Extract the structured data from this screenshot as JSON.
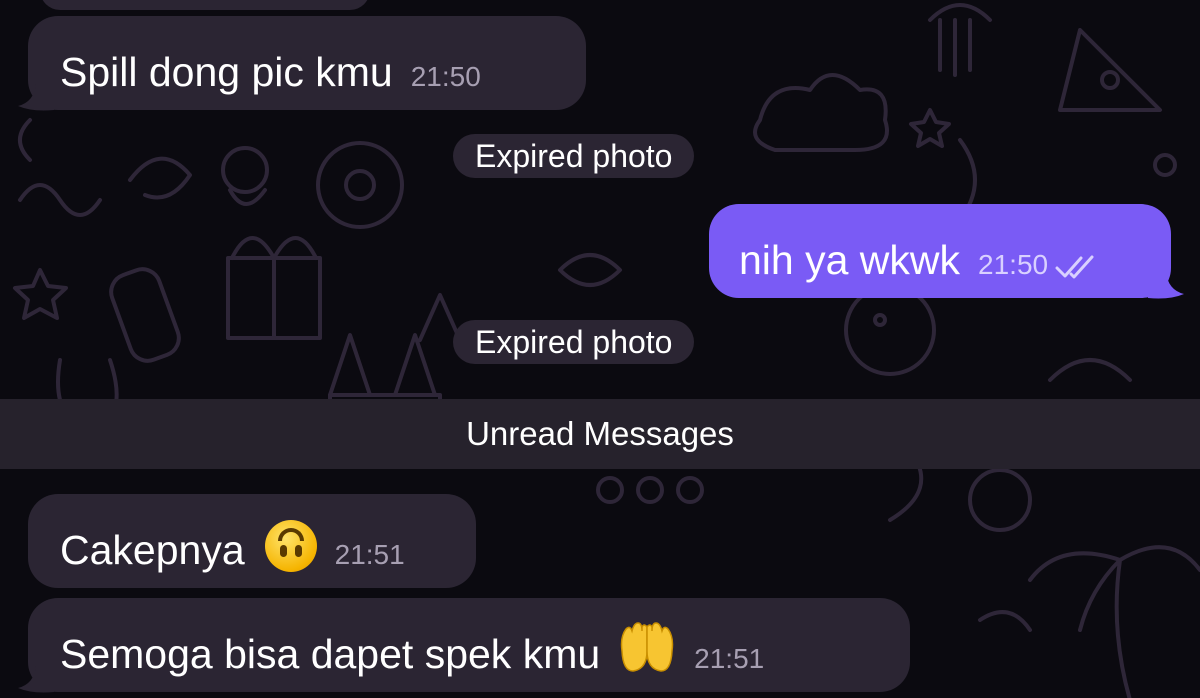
{
  "messages": {
    "m1": {
      "text": "Spill dong pic kmu",
      "time": "21:50"
    },
    "m2": {
      "text": "nih ya wkwk",
      "time": "21:50"
    },
    "m3": {
      "text": "Cakepnya",
      "time": "21:51",
      "emoji": "upside-down-face"
    },
    "m4": {
      "text": "Semoga bisa dapet spek kmu",
      "time": "21:51",
      "emoji": "raising-hands"
    }
  },
  "service": {
    "expired1": "Expired photo",
    "expired2": "Expired photo"
  },
  "unread": {
    "label": "Unread Messages"
  },
  "colors": {
    "background": "#0b0a10",
    "incoming_bubble": "#2b2533",
    "outgoing_bubble": "#7a5bf5",
    "unread_bar": "#26222c"
  },
  "icons": {
    "read_status": "double-check-icon"
  }
}
